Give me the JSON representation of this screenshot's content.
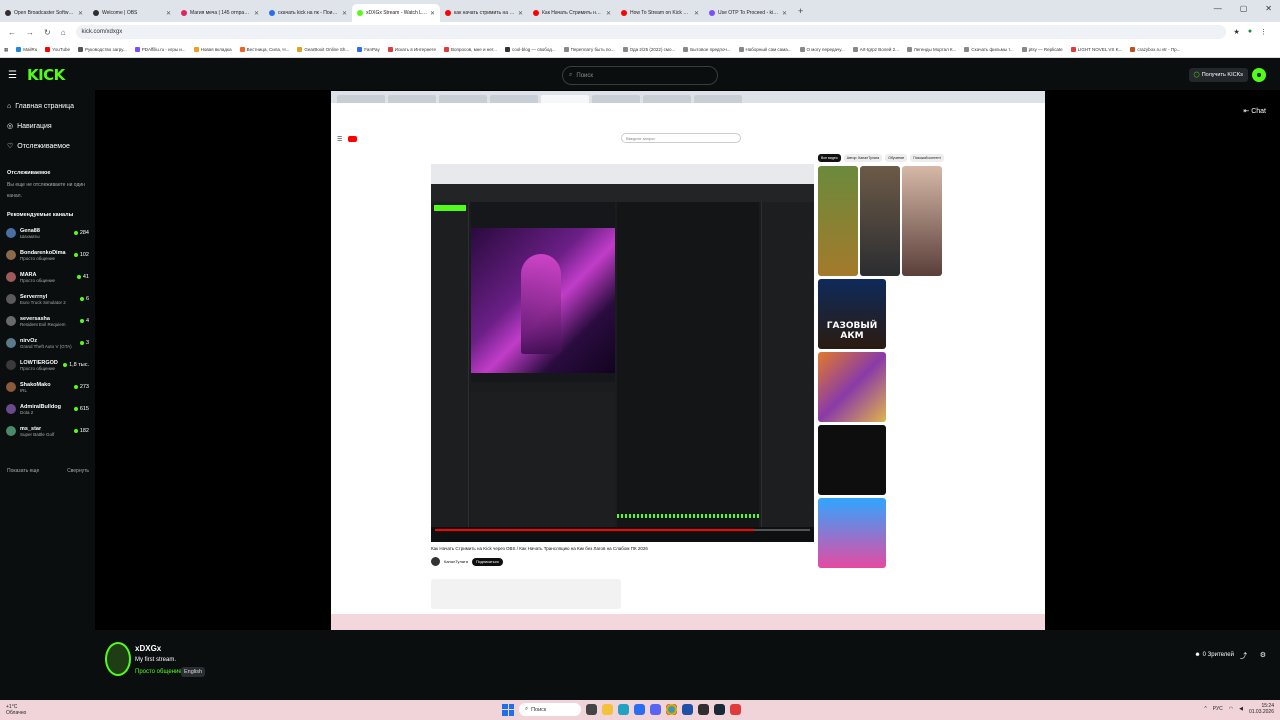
{
  "browser": {
    "tabs": [
      {
        "title": "Open Broadcaster Software | O...",
        "color": "#302e31"
      },
      {
        "title": "Welcome | OBS",
        "color": "#302e31"
      },
      {
        "title": "Магия меча | 145 отправки...",
        "color": "#e0245e"
      },
      {
        "title": "скачать kick на пк - Поиск в...",
        "color": "#2b6cf0"
      },
      {
        "title": "xDXGx Stream - Watch Live",
        "color": "#53fc18",
        "active": true
      },
      {
        "title": "как начать стримить на kick",
        "color": "#f00"
      },
      {
        "title": "Как Начать Стримить на Kick...",
        "color": "#f00"
      },
      {
        "title": "How To Stream on Kick Using...",
        "color": "#f00"
      },
      {
        "title": "Use OTP To Proceed - kirpyrgo",
        "color": "#7c4dff"
      }
    ],
    "new_tab": "+",
    "window_controls": {
      "minimize": "—",
      "maximize": "▢",
      "close": "✕"
    },
    "url": "kick.com/xdxgx",
    "bookmarks": [
      "MailRu",
      "YouTube",
      "Руководство загру...",
      "PDAffiliu.ru - игры и...",
      "Новая вкладка",
      "Вестница, Сила, Н...",
      "GearBoxit Online Sh...",
      "FanPay",
      "Искать в Интернете",
      "Вопросов, мне и нет...",
      "cool-blog — свобод...",
      "Переплату быть по...",
      "Ода 2/25 (2022) смо...",
      "Бытовое предпоч...",
      "Наборный сам сама...",
      "О могу передачу...",
      "Art-tgrpz Волей 2...",
      "Легенды Мортал К...",
      "Скачать фильмы т...",
      "ptsy — Replicate",
      "LIGHT NOVEL VS K...",
      "crazybox.ru vtr - Пр..."
    ]
  },
  "kick": {
    "logo": "KICK",
    "search_placeholder": "Поиск",
    "get_kicks": "Получить KICKs",
    "chat_button": "Chat",
    "nav": [
      {
        "label": "Главная страница",
        "icon": "home-icon"
      },
      {
        "label": "Навигация",
        "icon": "compass-icon"
      },
      {
        "label": "Отслеживаемое",
        "icon": "heart-icon"
      }
    ],
    "following_title": "Отслеживаемое",
    "following_empty": "Вы еще не отслеживаете ни один канал.",
    "recommended_title": "Рекомендуемые каналы",
    "channels": [
      {
        "name": "Gena88",
        "category": "Шахматы",
        "viewers": "284"
      },
      {
        "name": "BondarenkoDima",
        "category": "Просто общение",
        "viewers": "102"
      },
      {
        "name": "MARA",
        "category": "Просто общение",
        "viewers": "41"
      },
      {
        "name": "Serverrnyl",
        "category": "Euro Truck Simulator 2",
        "viewers": "6"
      },
      {
        "name": "seversasha",
        "category": "Resident Evil Requiem",
        "viewers": "4"
      },
      {
        "name": "nirvOz",
        "category": "Grand Theft Auto V (GTA)",
        "viewers": "3"
      },
      {
        "name": "LOWTIERGOD",
        "category": "Просто общение",
        "viewers": "1,8 тыс."
      },
      {
        "name": "ShakoMako",
        "category": "IRL",
        "viewers": "273"
      },
      {
        "name": "AdmiralBulldog",
        "category": "Dota 2",
        "viewers": "615"
      },
      {
        "name": "ms_star",
        "category": "Super Battle Golf",
        "viewers": "182"
      }
    ],
    "show_more": "Показать еще",
    "collapse": "Свернуть",
    "stream": {
      "name": "xDXGx",
      "title": "My first stream.",
      "category": "Просто общение",
      "tag": "English",
      "viewers": "0 Зрителей"
    }
  },
  "player": {
    "yt_search": "Введите запрос",
    "yt_title": "Как Начать Стримить на Kick через OBS / Как Начать Трансляцию на Кик без Лагов на Слабом ПК 2026",
    "yt_channel": "КаналТулата",
    "yt_subscribe": "Подписаться",
    "akm_label": "ГАЗОВЫЙ АКМ",
    "chips": [
      "Все видео",
      "Автор: КаналТулата",
      "Обучение",
      "Похожий контент"
    ]
  },
  "taskbar": {
    "weather": "+1°C",
    "weather_desc": "Облачно",
    "search": "Поиск",
    "lang": "РУС",
    "time": "15:24",
    "date": "01.03.2026"
  }
}
